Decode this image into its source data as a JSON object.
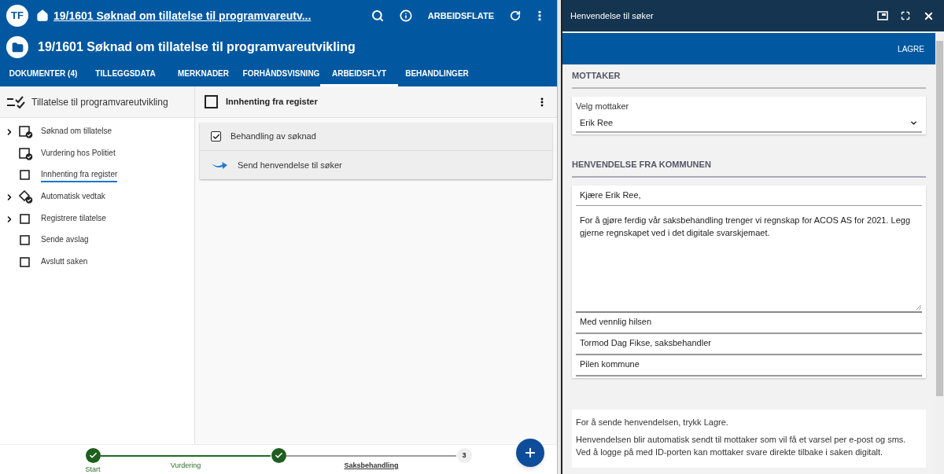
{
  "app_bar": {
    "logo": "TF",
    "breadcrumb": "19/1601 Søknad om tillatelse til programvareutv...",
    "workspace_button": "ARBEIDSFLATE"
  },
  "case_title": "19/1601 Søknad om tillatelse til programvareutvikling",
  "tabs": [
    {
      "label": "DOKUMENTER (4)",
      "selected": false
    },
    {
      "label": "TILLEGGSDATA",
      "selected": false
    },
    {
      "label": "MERKNADER",
      "selected": false
    },
    {
      "label": "FORHÅNDSVISNING",
      "selected": false
    },
    {
      "label": "ARBEIDSFLYT",
      "selected": true
    },
    {
      "label": "BEHANDLINGER",
      "selected": false
    }
  ],
  "workflow": {
    "title": "Tillatelse til programvareutvikling",
    "items": [
      {
        "label": "Søknad om tillatelse",
        "kind": "task-done",
        "expandable": true,
        "selected": false
      },
      {
        "label": "Vurdering hos Politiet",
        "kind": "task-done",
        "expandable": false,
        "selected": false
      },
      {
        "label": "Innhenting fra register",
        "kind": "task",
        "expandable": false,
        "selected": true
      },
      {
        "label": "Automatisk vedtak",
        "kind": "gateway-done",
        "expandable": true,
        "selected": false
      },
      {
        "label": "Registrere tilatelse",
        "kind": "task",
        "expandable": true,
        "selected": false
      },
      {
        "label": "Sende avslag",
        "kind": "task",
        "expandable": false,
        "selected": false
      },
      {
        "label": "Avslutt saken",
        "kind": "task",
        "expandable": false,
        "selected": false
      }
    ]
  },
  "detail": {
    "title": "Innhenting fra register",
    "checked": false,
    "actions": [
      {
        "label": "Behandling av søknad",
        "kind": "checkbox",
        "checked": true
      },
      {
        "label": "Send henvendelse til søker",
        "kind": "send"
      }
    ]
  },
  "stepper": [
    {
      "label": "Start",
      "kind": "done"
    },
    {
      "label": "Vurdering",
      "kind": "done"
    },
    {
      "label": "Saksbehandling",
      "kind": "current",
      "number": "3"
    }
  ],
  "panel": {
    "title": "Henvendelse til søker",
    "save_button": "LAGRE",
    "recipient_heading": "MOTTAKER",
    "recipient_label": "Velg mottaker",
    "recipient_value": "Erik Ree",
    "message_heading": "HENVENDELSE FRA KOMMUNEN",
    "greeting": "Kjære Erik Ree,",
    "body": "For å gjøre ferdig vår saksbehandling trenger vi regnskap for ACOS AS for 2021. Legg gjerne regnskapet ved i det digitale svarskjemaet.",
    "closing": [
      "Med vennlig hilsen",
      "Tormod Dag Fikse, saksbehandler",
      "Pilen kommune"
    ],
    "info": [
      "For å sende henvendelsen, trykk Lagre.",
      "Henvendelsen blir automatisk sendt til mottaker som vil få et varsel per e-post og sms. Ved å logge på med ID-porten kan mottaker svare direkte tilbake i saken digitalt."
    ]
  }
}
